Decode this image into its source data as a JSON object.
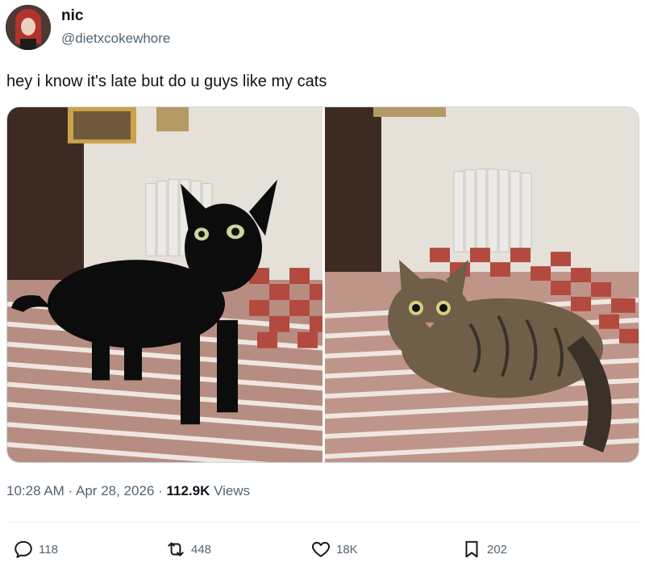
{
  "author": {
    "display_name": "nic",
    "handle": "@dietxcokewhore"
  },
  "tweet": {
    "text": "hey i know it's late but do u guys like my cats",
    "time": "10:28 AM",
    "date": "Apr 28, 2026",
    "views_count": "112.9K",
    "views_label": "Views"
  },
  "metrics": {
    "replies": "118",
    "reposts": "448",
    "likes": "18K",
    "bookmarks": "202"
  },
  "colors": {
    "text_primary": "#0f1419",
    "text_secondary": "#536471",
    "divider": "#eff3f4"
  }
}
